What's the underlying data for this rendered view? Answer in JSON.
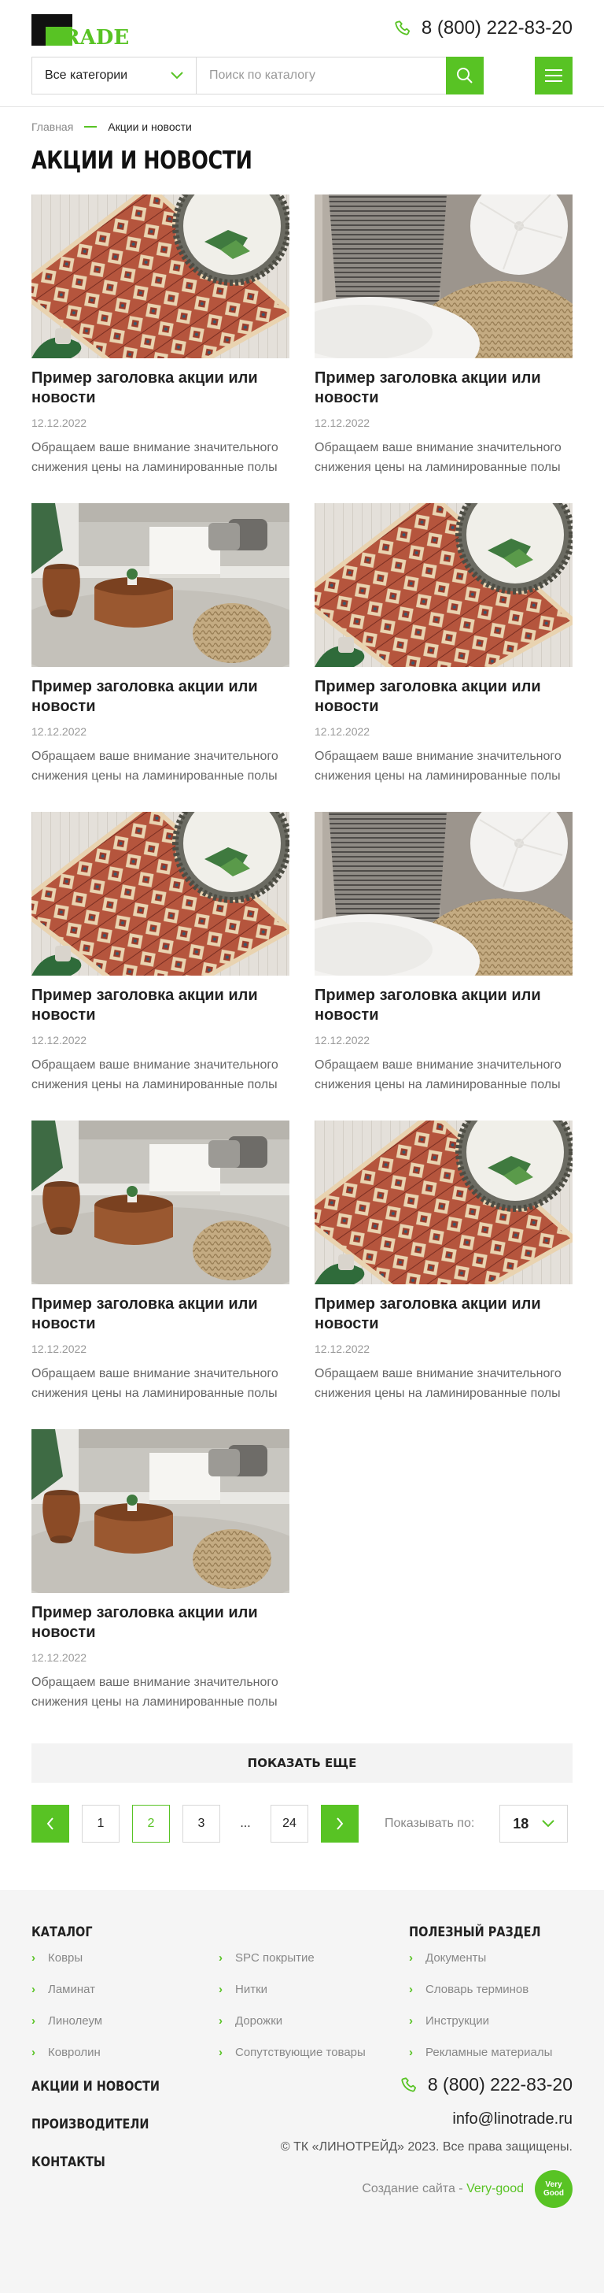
{
  "header": {
    "logo_text": "RADE",
    "phone": "8 (800) 222-83-20",
    "category_select": "Все категории",
    "search_placeholder": "Поиск по каталогу"
  },
  "breadcrumb": {
    "home": "Главная",
    "current": "Акции и новости"
  },
  "page_title": "АКЦИИ И НОВОСТИ",
  "cards": [
    {
      "image": "rug-mirror",
      "title": "Пример заголовка акции или новости",
      "date": "12.12.2022",
      "desc": "Обращаем ваше внимание значительного снижения цены на ламинированные полы"
    },
    {
      "image": "pillows-pouf",
      "title": "Пример заголовка акции или новости",
      "date": "12.12.2022",
      "desc": "Обращаем ваше внимание значительного снижения цены на ламинированные полы"
    },
    {
      "image": "sofa-tables",
      "title": "Пример заголовка акции или новости",
      "date": "12.12.2022",
      "desc": "Обращаем ваше внимание значительного снижения цены на ламинированные полы"
    },
    {
      "image": "rug-mirror",
      "title": "Пример заголовка акции или новости",
      "date": "12.12.2022",
      "desc": "Обращаем ваше внимание значительного снижения цены на ламинированные полы"
    },
    {
      "image": "rug-mirror",
      "title": "Пример заголовка акции или новости",
      "date": "12.12.2022",
      "desc": "Обращаем ваше внимание значительного снижения цены на ламинированные полы"
    },
    {
      "image": "pillows-pouf",
      "title": "Пример заголовка акции или новости",
      "date": "12.12.2022",
      "desc": "Обращаем ваше внимание значительного снижения цены на ламинированные полы"
    },
    {
      "image": "sofa-tables",
      "title": "Пример заголовка акции или новости",
      "date": "12.12.2022",
      "desc": "Обращаем ваше внимание значительного снижения цены на ламинированные полы"
    },
    {
      "image": "rug-mirror",
      "title": "Пример заголовка акции или новости",
      "date": "12.12.2022",
      "desc": "Обращаем ваше внимание значительного снижения цены на ламинированные полы"
    },
    {
      "image": "sofa-tables",
      "title": "Пример заголовка акции или новости",
      "date": "12.12.2022",
      "desc": "Обращаем ваше внимание значительного снижения цены на ламинированные полы"
    }
  ],
  "show_more": "ПОКАЗАТЬ ЕЩЕ",
  "pagination": {
    "pages": [
      "1",
      "2",
      "3",
      "...",
      "24"
    ],
    "active_page": "2",
    "per_page_label": "Показывать по:",
    "per_page_value": "18"
  },
  "footer": {
    "catalog_heading": "КАТАЛОГ",
    "catalog_col1": [
      "Ковры",
      "Ламинат",
      "Линолеум",
      "Ковролин"
    ],
    "catalog_col2": [
      "SPC покрытие",
      "Нитки",
      "Дорожки",
      "Сопутствующие товары"
    ],
    "useful_heading": "ПОЛЕЗНЫЙ РАЗДЕЛ",
    "useful_items": [
      "Документы",
      "Словарь терминов",
      "Инструкции",
      "Рекламные материалы"
    ],
    "links": [
      "АКЦИИ И НОВОСТИ",
      "ПРОИЗВОДИТЕЛИ",
      "КОНТАКТЫ"
    ],
    "phone": "8 (800) 222-83-20",
    "email": "info@linotrade.ru",
    "copyright": "© ТК «ЛИНОТРЕЙД» 2023. Все права защищены.",
    "credit_prefix": "Создание сайта - ",
    "credit_name": "Very-good",
    "credit_badge": "Very Good"
  },
  "colors": {
    "accent": "#58c324",
    "footer_bg": "#f5f5f5"
  }
}
